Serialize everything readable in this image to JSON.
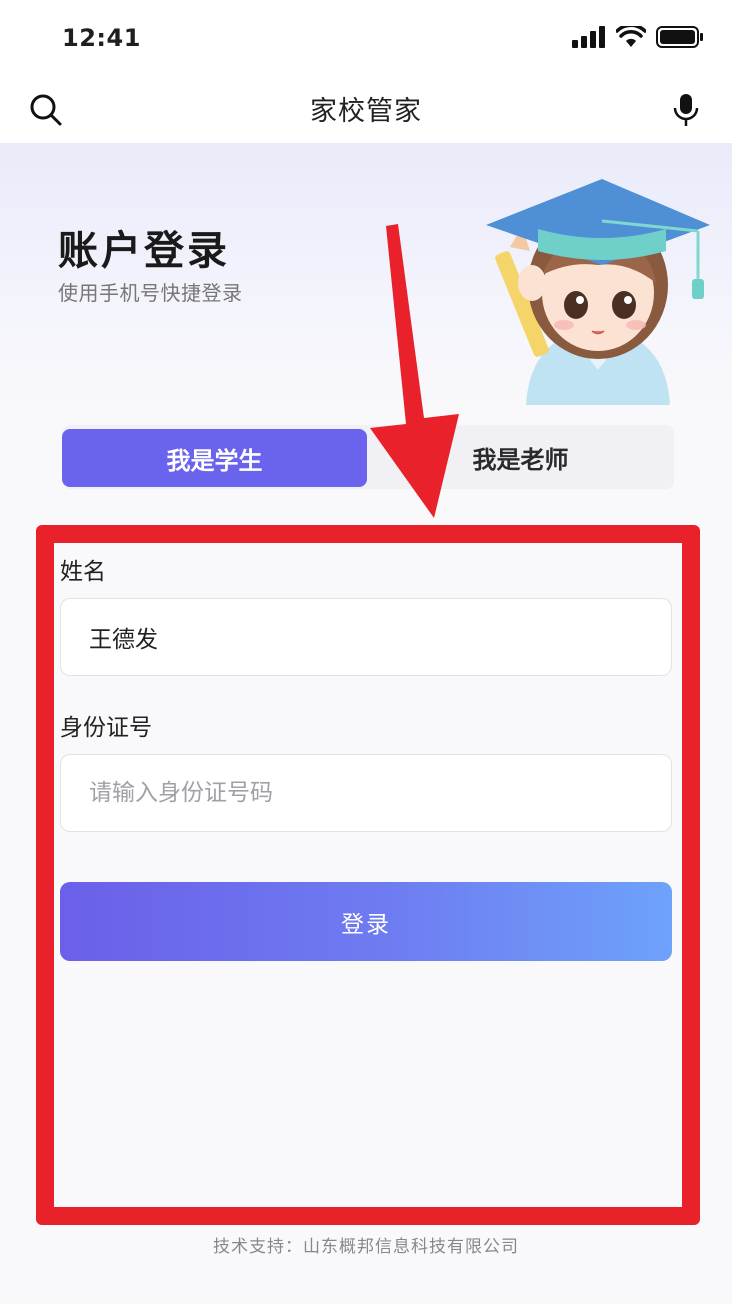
{
  "status_bar": {
    "time": "12:41"
  },
  "nav": {
    "title": "家校管家"
  },
  "hero": {
    "title": "账户登录",
    "subtitle": "使用手机号快捷登录"
  },
  "tabs": [
    {
      "label": "我是学生",
      "selected": true
    },
    {
      "label": "我是老师",
      "selected": false
    }
  ],
  "form": {
    "name": {
      "label": "姓名",
      "value": "王德发"
    },
    "id_number": {
      "label": "身份证号",
      "value": "",
      "placeholder": "请输入身份证号码"
    },
    "submit_label": "登录"
  },
  "footer": {
    "text": "技术支持：山东概邦信息科技有限公司"
  },
  "colors": {
    "accent": "#6a63ee",
    "highlight": "#e8212b"
  }
}
